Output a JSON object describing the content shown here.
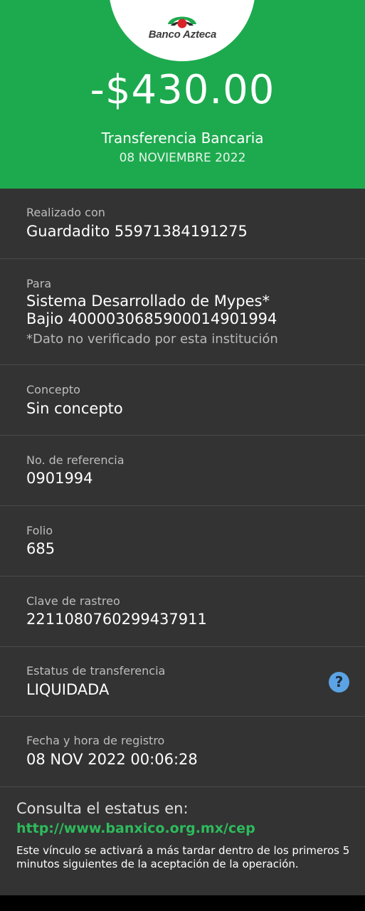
{
  "header": {
    "bank_name": "Banco Azteca",
    "amount": "-$430.00",
    "transaction_type": "Transferencia Bancaria",
    "date": "08 NOVIEMBRE 2022",
    "background_color": "#1daa4e"
  },
  "details": {
    "realizado_con": {
      "label": "Realizado con",
      "value": "Guardadito 55971384191275"
    },
    "para": {
      "label": "Para",
      "line1": "Sistema Desarrollado de Mypes*",
      "line2": "Bajio 4000030685900014901994",
      "note": "*Dato no verificado por esta institución"
    },
    "concepto": {
      "label": "Concepto",
      "value": "Sin concepto"
    },
    "referencia": {
      "label": "No. de referencia",
      "value": "0901994"
    },
    "folio": {
      "label": "Folio",
      "value": "685"
    },
    "clave_rastreo": {
      "label": "Clave de rastreo",
      "value": "2211080760299437911"
    },
    "estatus": {
      "label": "Estatus de transferencia",
      "value": "LIQUIDADA",
      "help_icon": "help-question-icon"
    },
    "fecha_registro": {
      "label": "Fecha y hora de registro",
      "value": "08 NOV 2022 00:06:28"
    }
  },
  "footer": {
    "title": "Consulta el estatus en:",
    "link": "http://www.banxico.org.mx/cep",
    "note": "Este vínculo se activará a más tardar dentro de los primeros 5 minutos siguientes de la aceptación de la operación.",
    "link_color": "#2dbb5c"
  }
}
